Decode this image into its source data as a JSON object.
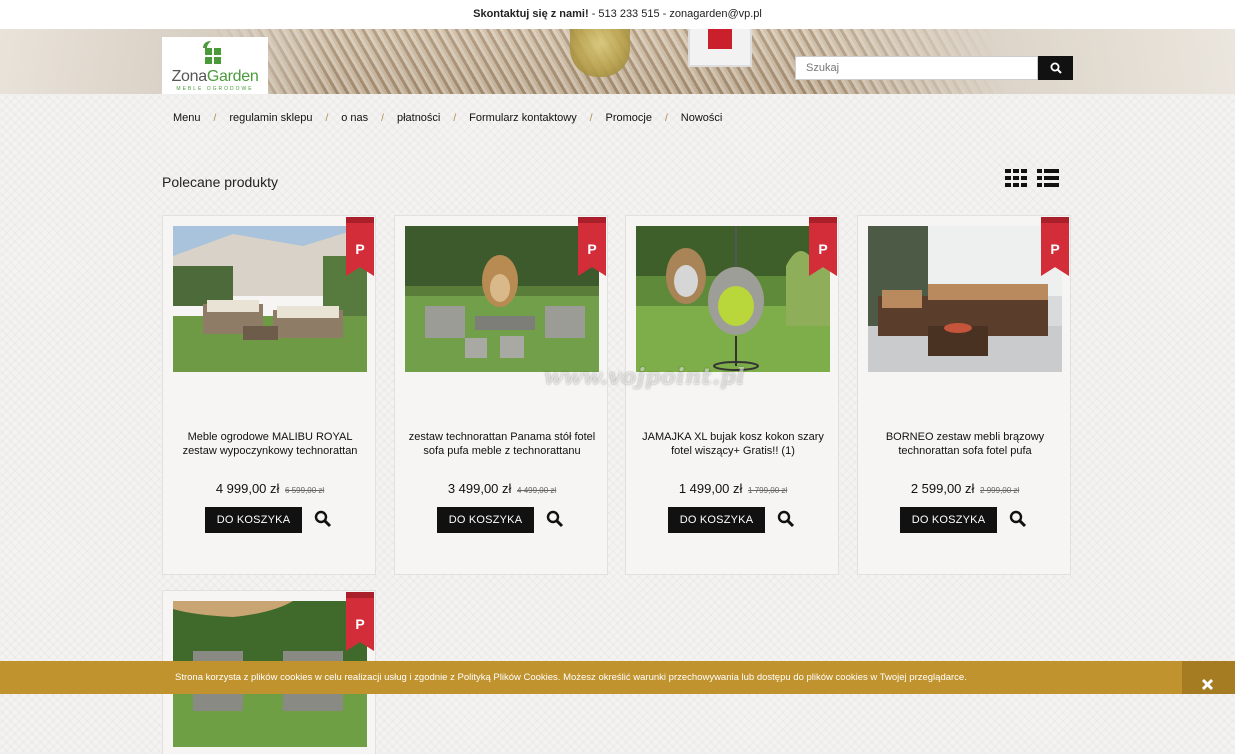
{
  "topbar": {
    "contact_label": "Skontaktuj się z nami!",
    "contact_rest": " - 513 233 515 - zonagarden@vp.pl"
  },
  "logo": {
    "name_part1": "Zona",
    "name_part2": "Garden",
    "tagline": "MEBLE OGRODOWE"
  },
  "search": {
    "placeholder": "Szukaj",
    "value": ""
  },
  "nav": {
    "items": [
      "Menu",
      "regulamin sklepu",
      "o nas",
      "płatności",
      "Formularz kontaktowy",
      "Promocje",
      "Nowości"
    ],
    "separator": "/"
  },
  "section": {
    "title": "Polecane produkty"
  },
  "products": [
    {
      "name": "Meble ogrodowe MALIBU ROYAL zestaw wypoczynkowy technorattan",
      "price": "4 999,00 zł",
      "old_price": "6 599,00 zł",
      "badge": "P",
      "button": "DO KOSZYKA"
    },
    {
      "name": "zestaw technorattan Panama stół fotel sofa pufa meble z technorattanu",
      "price": "3 499,00 zł",
      "old_price": "4 499,00 zł",
      "badge": "P",
      "button": "DO KOSZYKA"
    },
    {
      "name": "JAMAJKA XL bujak kosz kokon szary fotel wiszący+ Gratis!! (1)",
      "price": "1 499,00 zł",
      "old_price": "1 799,00 zł",
      "badge": "P",
      "button": "DO KOSZYKA"
    },
    {
      "name": "BORNEO zestaw mebli brązowy technorattan sofa fotel pufa",
      "price": "2 599,00 zł",
      "old_price": "2 999,00 zł",
      "badge": "P",
      "button": "DO KOSZYKA"
    },
    {
      "badge": "P"
    }
  ],
  "watermark": "www.vojpoint.pl",
  "cookie": {
    "text": "Strona korzysta z plików cookies w celu realizacji usług i zgodnie z Polityką Plików Cookies. Możesz określić warunki przechowywania lub dostępu do plików cookies w Twojej przeglądarce."
  },
  "colors": {
    "accent": "#c0932f",
    "badge": "#d32d3a",
    "button": "#111111",
    "logo_green": "#4a9a3a"
  },
  "icons": {
    "search": "search-icon",
    "grid": "grid-view-icon",
    "list": "list-view-icon",
    "zoom": "zoom-icon",
    "close": "close-icon"
  }
}
